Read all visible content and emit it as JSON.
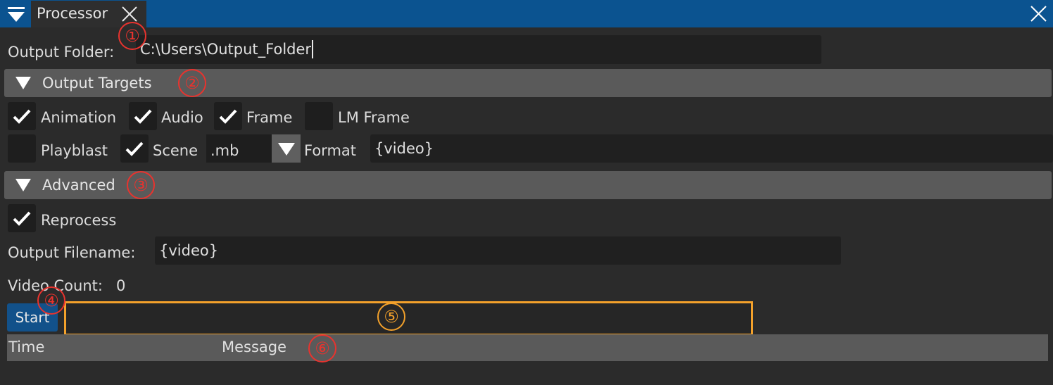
{
  "window": {
    "tab_title": "Processor",
    "menu_icon": "dropdown-menu-icon",
    "tab_close_icon": "close-icon",
    "window_close_icon": "close-icon",
    "accent_color": "#0b5390"
  },
  "output_folder": {
    "label": "Output Folder:",
    "value": "C:\\Users\\Output_Folder"
  },
  "output_targets": {
    "title": "Output Targets",
    "checkboxes": [
      {
        "label": "Animation",
        "checked": true
      },
      {
        "label": "Audio",
        "checked": true
      },
      {
        "label": "Frame",
        "checked": true
      },
      {
        "label": "LM Frame",
        "checked": false
      },
      {
        "label": "Playblast",
        "checked": false
      },
      {
        "label": "Scene",
        "checked": true
      }
    ],
    "scene_format_select": ".mb",
    "format_label": "Format",
    "format_value": "{video}"
  },
  "advanced": {
    "title": "Advanced",
    "reprocess": {
      "label": "Reprocess",
      "checked": true
    },
    "output_filename_label": "Output Filename:",
    "output_filename_value": "{video}",
    "video_count_label": "Video Count:",
    "video_count_value": "0"
  },
  "actions": {
    "start_label": "Start",
    "start_color": "#12518a",
    "progress_value": 0
  },
  "log": {
    "columns": [
      "Time",
      "Message"
    ]
  },
  "annotations": [
    "①",
    "②",
    "③",
    "④",
    "⑤",
    "⑥"
  ],
  "annotation_colors": {
    "red": "#e8332e",
    "orange": "#f3a12b"
  }
}
